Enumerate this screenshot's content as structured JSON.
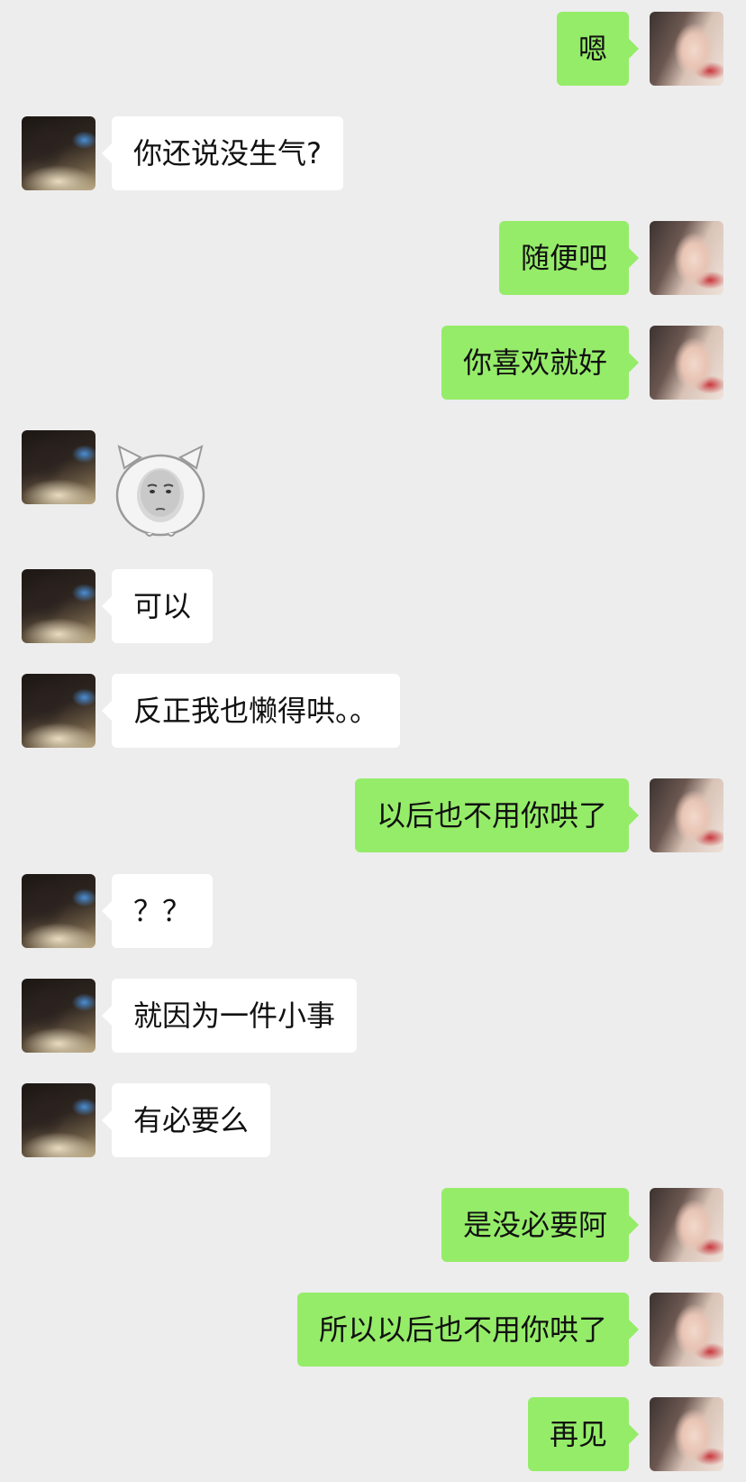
{
  "messages": [
    {
      "side": "out",
      "text": "嗯"
    },
    {
      "side": "in",
      "text": "你还说没生气?"
    },
    {
      "side": "out",
      "text": "随便吧"
    },
    {
      "side": "out",
      "text": "你喜欢就好"
    },
    {
      "side": "in",
      "sticker": "chubby-baby-face-sticker"
    },
    {
      "side": "in",
      "text": "可以"
    },
    {
      "side": "in",
      "text": "反正我也懒得哄。。"
    },
    {
      "side": "out",
      "text": "以后也不用你哄了"
    },
    {
      "side": "in",
      "text": "？？"
    },
    {
      "side": "in",
      "text": "就因为一件小事"
    },
    {
      "side": "in",
      "text": "有必要么"
    },
    {
      "side": "out",
      "text": "是没必要阿"
    },
    {
      "side": "out",
      "text": "所以以后也不用你哄了"
    },
    {
      "side": "out",
      "text": "再见"
    }
  ],
  "colors": {
    "background": "#ededed",
    "outgoing_bubble": "#95ec69",
    "incoming_bubble": "#ffffff"
  }
}
